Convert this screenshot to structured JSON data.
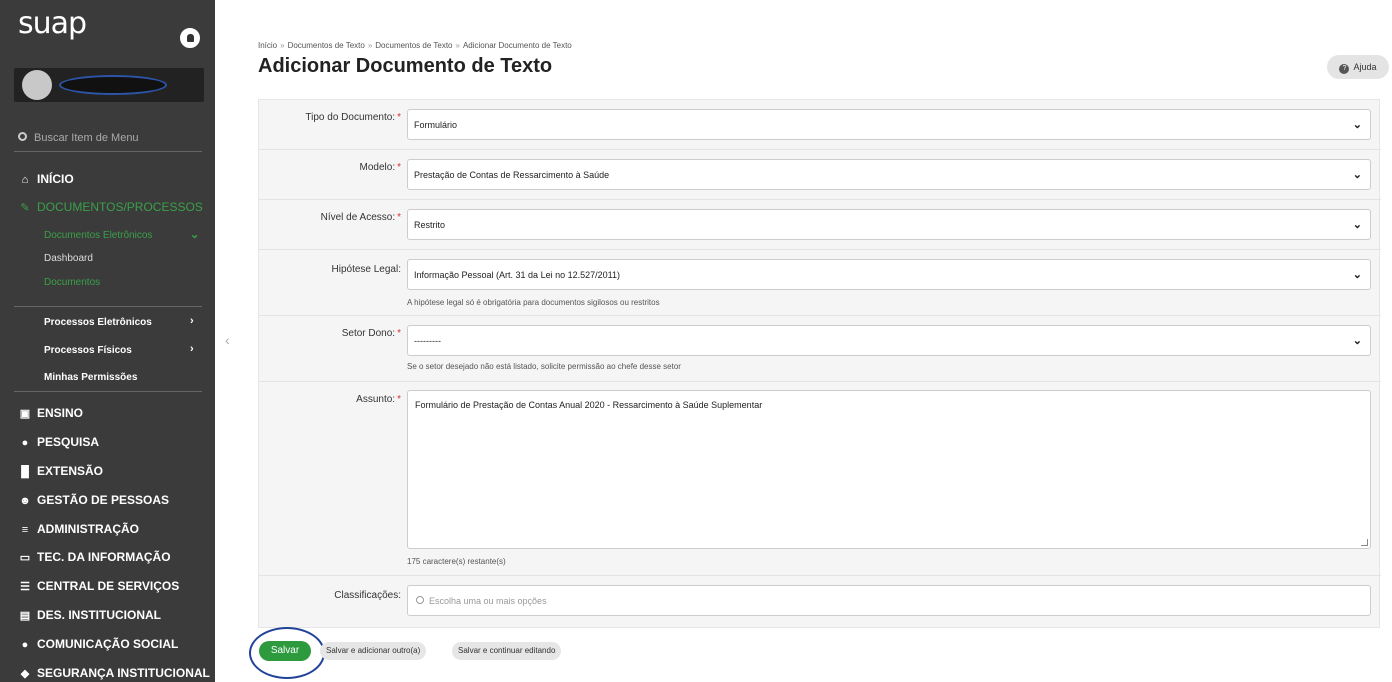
{
  "app": {
    "logo": "suap"
  },
  "sidebar": {
    "search_placeholder": "Buscar Item de Menu",
    "inicio": "INÍCIO",
    "documentos_processos": "DOCUMENTOS/PROCESSOS",
    "docs_eletronicos": "Documentos Eletrônicos",
    "dashboard": "Dashboard",
    "documentos": "Documentos",
    "processos_eletronicos": "Processos Eletrônicos",
    "processos_fisicos": "Processos Físicos",
    "minhas_permissoes": "Minhas Permissões",
    "sections": [
      "ENSINO",
      "PESQUISA",
      "EXTENSÃO",
      "GESTÃO DE PESSOAS",
      "ADMINISTRAÇÃO",
      "TEC. DA INFORMAÇÃO",
      "CENTRAL DE SERVIÇOS",
      "DES. INSTITUCIONAL",
      "COMUNICAÇÃO SOCIAL",
      "SEGURANÇA INSTITUCIONAL"
    ]
  },
  "breadcrumb": [
    "Início",
    "Documentos de Texto",
    "Documentos de Texto",
    "Adicionar Documento de Texto"
  ],
  "header": {
    "title": "Adicionar Documento de Texto",
    "help": "Ajuda"
  },
  "form": {
    "tipo_label": "Tipo do Documento:",
    "tipo_value": "Formulário",
    "modelo_label": "Modelo:",
    "modelo_value": "Prestação de Contas de Ressarcimento à Saúde",
    "nivel_label": "Nível de Acesso:",
    "nivel_value": "Restrito",
    "hipotese_label": "Hipótese Legal:",
    "hipotese_value": "Informação Pessoal (Art. 31 da Lei no 12.527/2011)",
    "hipotese_help": "A hipótese legal só é obrigatória para documentos sigilosos ou restritos",
    "setor_label": "Setor Dono:",
    "setor_value": "---------",
    "setor_help": "Se o setor desejado não está listado, solicite permissão ao chefe desse setor",
    "assunto_label": "Assunto:",
    "assunto_value": "Formulário de Prestação de Contas Anual 2020 - Ressarcimento à Saúde Suplementar",
    "assunto_help": "175 caractere(s) restante(s)",
    "classificacoes_label": "Classificações:",
    "classificacoes_placeholder": "Escolha uma ou mais opções"
  },
  "actions": {
    "salvar": "Salvar",
    "salvar_adicionar": "Salvar e adicionar outro(a)",
    "salvar_continuar": "Salvar e continuar editando"
  }
}
